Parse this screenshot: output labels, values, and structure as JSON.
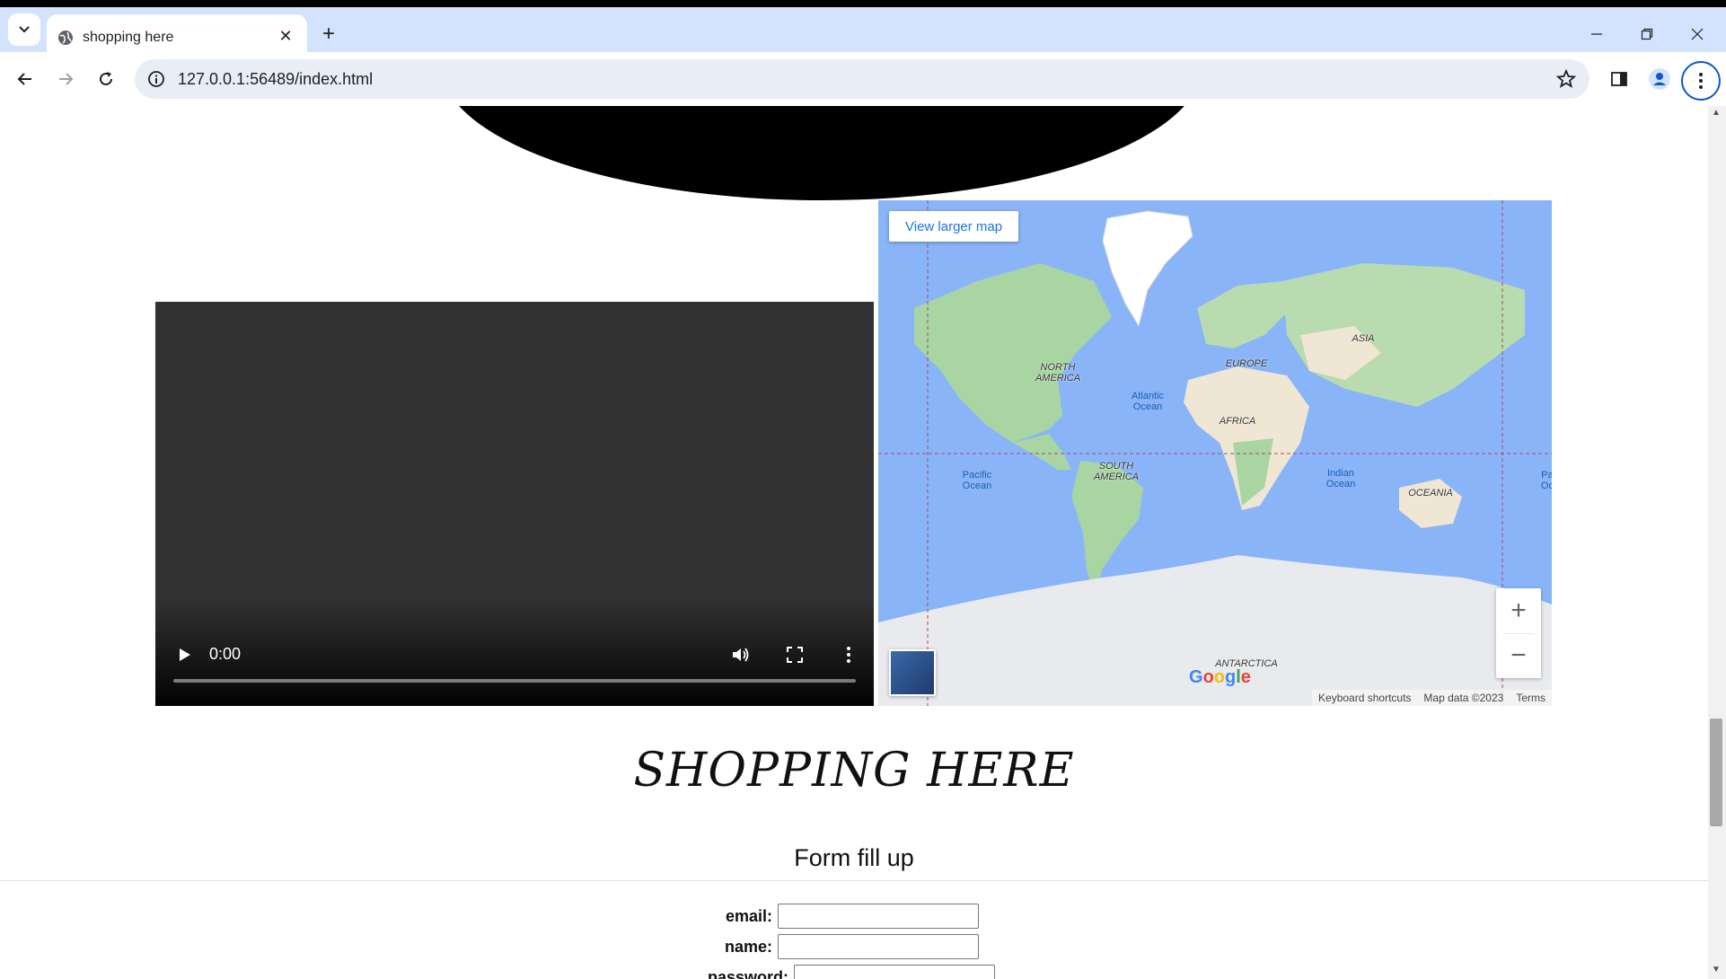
{
  "browser": {
    "tab_title": "shopping here",
    "url": "127.0.0.1:56489/index.html"
  },
  "video": {
    "time": "0:00"
  },
  "map": {
    "view_larger_label": "View larger map",
    "zoom_in": "+",
    "zoom_out": "−",
    "footer": [
      "Keyboard shortcuts",
      "Map data ©2023",
      "Terms"
    ],
    "continents": [
      "NORTH AMERICA",
      "SOUTH AMERICA",
      "EUROPE",
      "AFRICA",
      "ASIA",
      "OCEANIA",
      "ANTARCTICA"
    ],
    "oceans": [
      "Atlantic Ocean",
      "Pacific Ocean",
      "Indian Ocean",
      "Pa Oc"
    ],
    "logo": "Google"
  },
  "page": {
    "title": "SHOPPING HERE",
    "form_heading": "Form fill up",
    "fields": [
      {
        "label": "email:"
      },
      {
        "label": "name:"
      },
      {
        "label": "password:"
      }
    ]
  }
}
